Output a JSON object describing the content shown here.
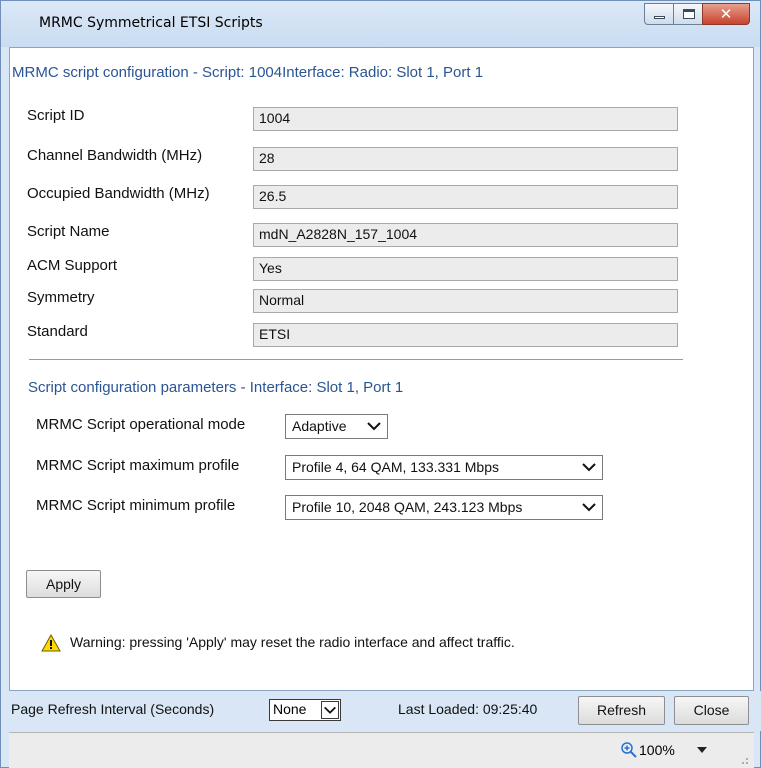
{
  "window": {
    "title": "MRMC Symmetrical ETSI Scripts",
    "close_glyph": "✕"
  },
  "config_section": {
    "title": "MRMC script configuration - Script: 1004Interface: Radio: Slot 1, Port 1",
    "fields": [
      {
        "label": "Script ID",
        "value": "1004"
      },
      {
        "label": "Channel Bandwidth (MHz)",
        "value": "28"
      },
      {
        "label": "Occupied Bandwidth (MHz)",
        "value": "26.5"
      },
      {
        "label": "Script Name",
        "value": "mdN_A2828N_157_1004"
      },
      {
        "label": "ACM Support",
        "value": "Yes"
      },
      {
        "label": "Symmetry",
        "value": "Normal"
      },
      {
        "label": "Standard",
        "value": "ETSI"
      }
    ]
  },
  "params_section": {
    "title": "Script configuration parameters - Interface: Slot 1, Port 1",
    "operational_mode": {
      "label": "MRMC Script operational mode",
      "value": "Adaptive"
    },
    "max_profile": {
      "label": "MRMC Script maximum profile",
      "value": "Profile 4, 64 QAM, 133.331 Mbps"
    },
    "min_profile": {
      "label": "MRMC Script minimum profile",
      "value": "Profile 10, 2048 QAM, 243.123 Mbps"
    }
  },
  "apply_label": "Apply",
  "warning": {
    "icon": "warning-triangle-icon",
    "text": "Warning: pressing 'Apply' may reset the radio interface and affect traffic."
  },
  "footer": {
    "refresh_interval_label": "Page Refresh Interval (Seconds)",
    "refresh_interval_value": "None",
    "last_loaded": "Last Loaded: 09:25:40",
    "refresh_label": "Refresh",
    "close_label": "Close"
  },
  "status": {
    "zoom": "100%"
  },
  "colors": {
    "accent": "#2a5594",
    "chrome": "#d8e6f5",
    "field_bg": "#ececec",
    "warning": "#ffd800"
  }
}
